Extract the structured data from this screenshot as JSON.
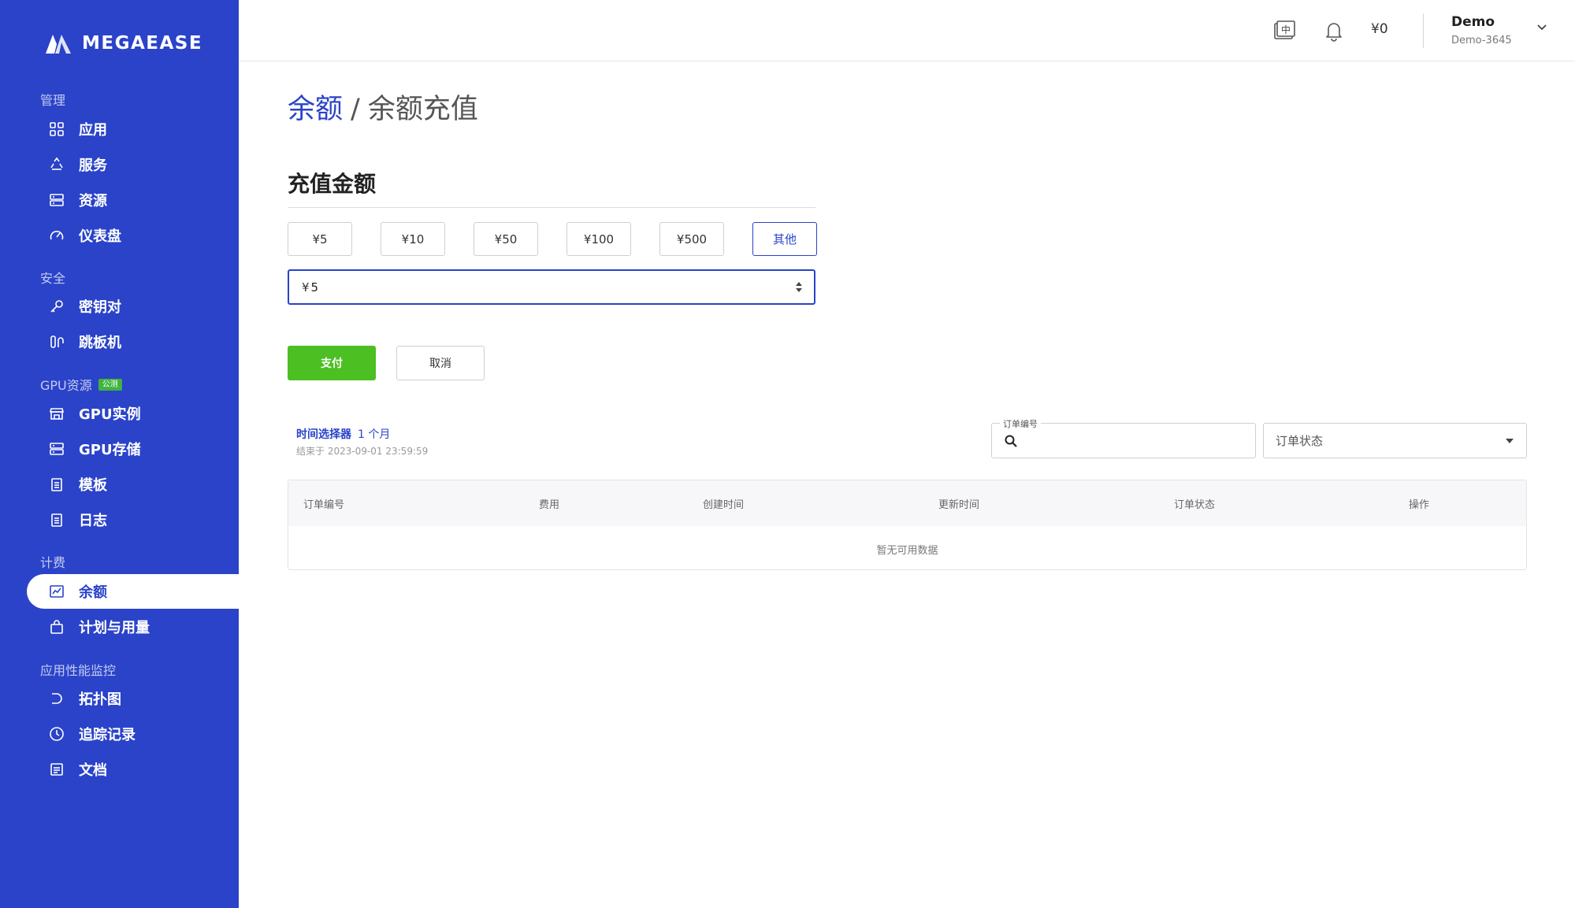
{
  "brand": {
    "name": "MEGAEASE"
  },
  "sidebar": {
    "sections": [
      {
        "title": "管理"
      },
      {
        "title": "安全"
      },
      {
        "title": "GPU资源",
        "badge": "公测"
      },
      {
        "title": "计费"
      },
      {
        "title": "应用性能监控"
      }
    ],
    "items": [
      {
        "label": "应用",
        "icon": "grid-icon"
      },
      {
        "label": "服务",
        "icon": "recycle-icon"
      },
      {
        "label": "资源",
        "icon": "server-icon"
      },
      {
        "label": "仪表盘",
        "icon": "gauge-icon"
      },
      {
        "label": "密钥对",
        "icon": "key-icon"
      },
      {
        "label": "跳板机",
        "icon": "jump-host-icon"
      },
      {
        "label": "GPU实例",
        "icon": "store-icon"
      },
      {
        "label": "GPU存储",
        "icon": "storage-icon"
      },
      {
        "label": "模板",
        "icon": "clipboard-icon"
      },
      {
        "label": "日志",
        "icon": "log-icon"
      },
      {
        "label": "余额",
        "icon": "chart-line-icon",
        "active": true
      },
      {
        "label": "计划与用量",
        "icon": "shopping-bag-icon"
      },
      {
        "label": "拓扑图",
        "icon": "topology-icon"
      },
      {
        "label": "追踪记录",
        "icon": "clock-icon"
      },
      {
        "label": "文档",
        "icon": "document-icon"
      }
    ]
  },
  "header": {
    "language_icon_text": "中",
    "balance": "¥0",
    "user_name": "Demo",
    "user_sub": "Demo-3645"
  },
  "breadcrumb": {
    "parent": "余额",
    "separator": "/",
    "current": "余额充值"
  },
  "recharge": {
    "title": "充值金额",
    "amounts": [
      "¥5",
      "¥10",
      "¥50",
      "¥100",
      "¥500",
      "其他"
    ],
    "selected_index": 5,
    "currency_prefix": "¥",
    "input_value": "5",
    "pay_label": "支付",
    "cancel_label": "取消"
  },
  "filters": {
    "time_picker_label": "时间选择器",
    "time_range": "1 个月",
    "time_end": "结束于 2023-09-01 23:59:59",
    "order_no_label": "订单编号",
    "order_no_value": "",
    "status_placeholder": "订单状态"
  },
  "table": {
    "columns": [
      "订单编号",
      "费用",
      "创建时间",
      "更新时间",
      "订单状态",
      "操作"
    ],
    "rows": [],
    "empty_text": "暂无可用数据"
  },
  "colors": {
    "sidebar_bg": "#2a43c9",
    "accent": "#2a43c9",
    "pay_button": "#4cbf22",
    "beta_badge": "#3fb33f"
  }
}
